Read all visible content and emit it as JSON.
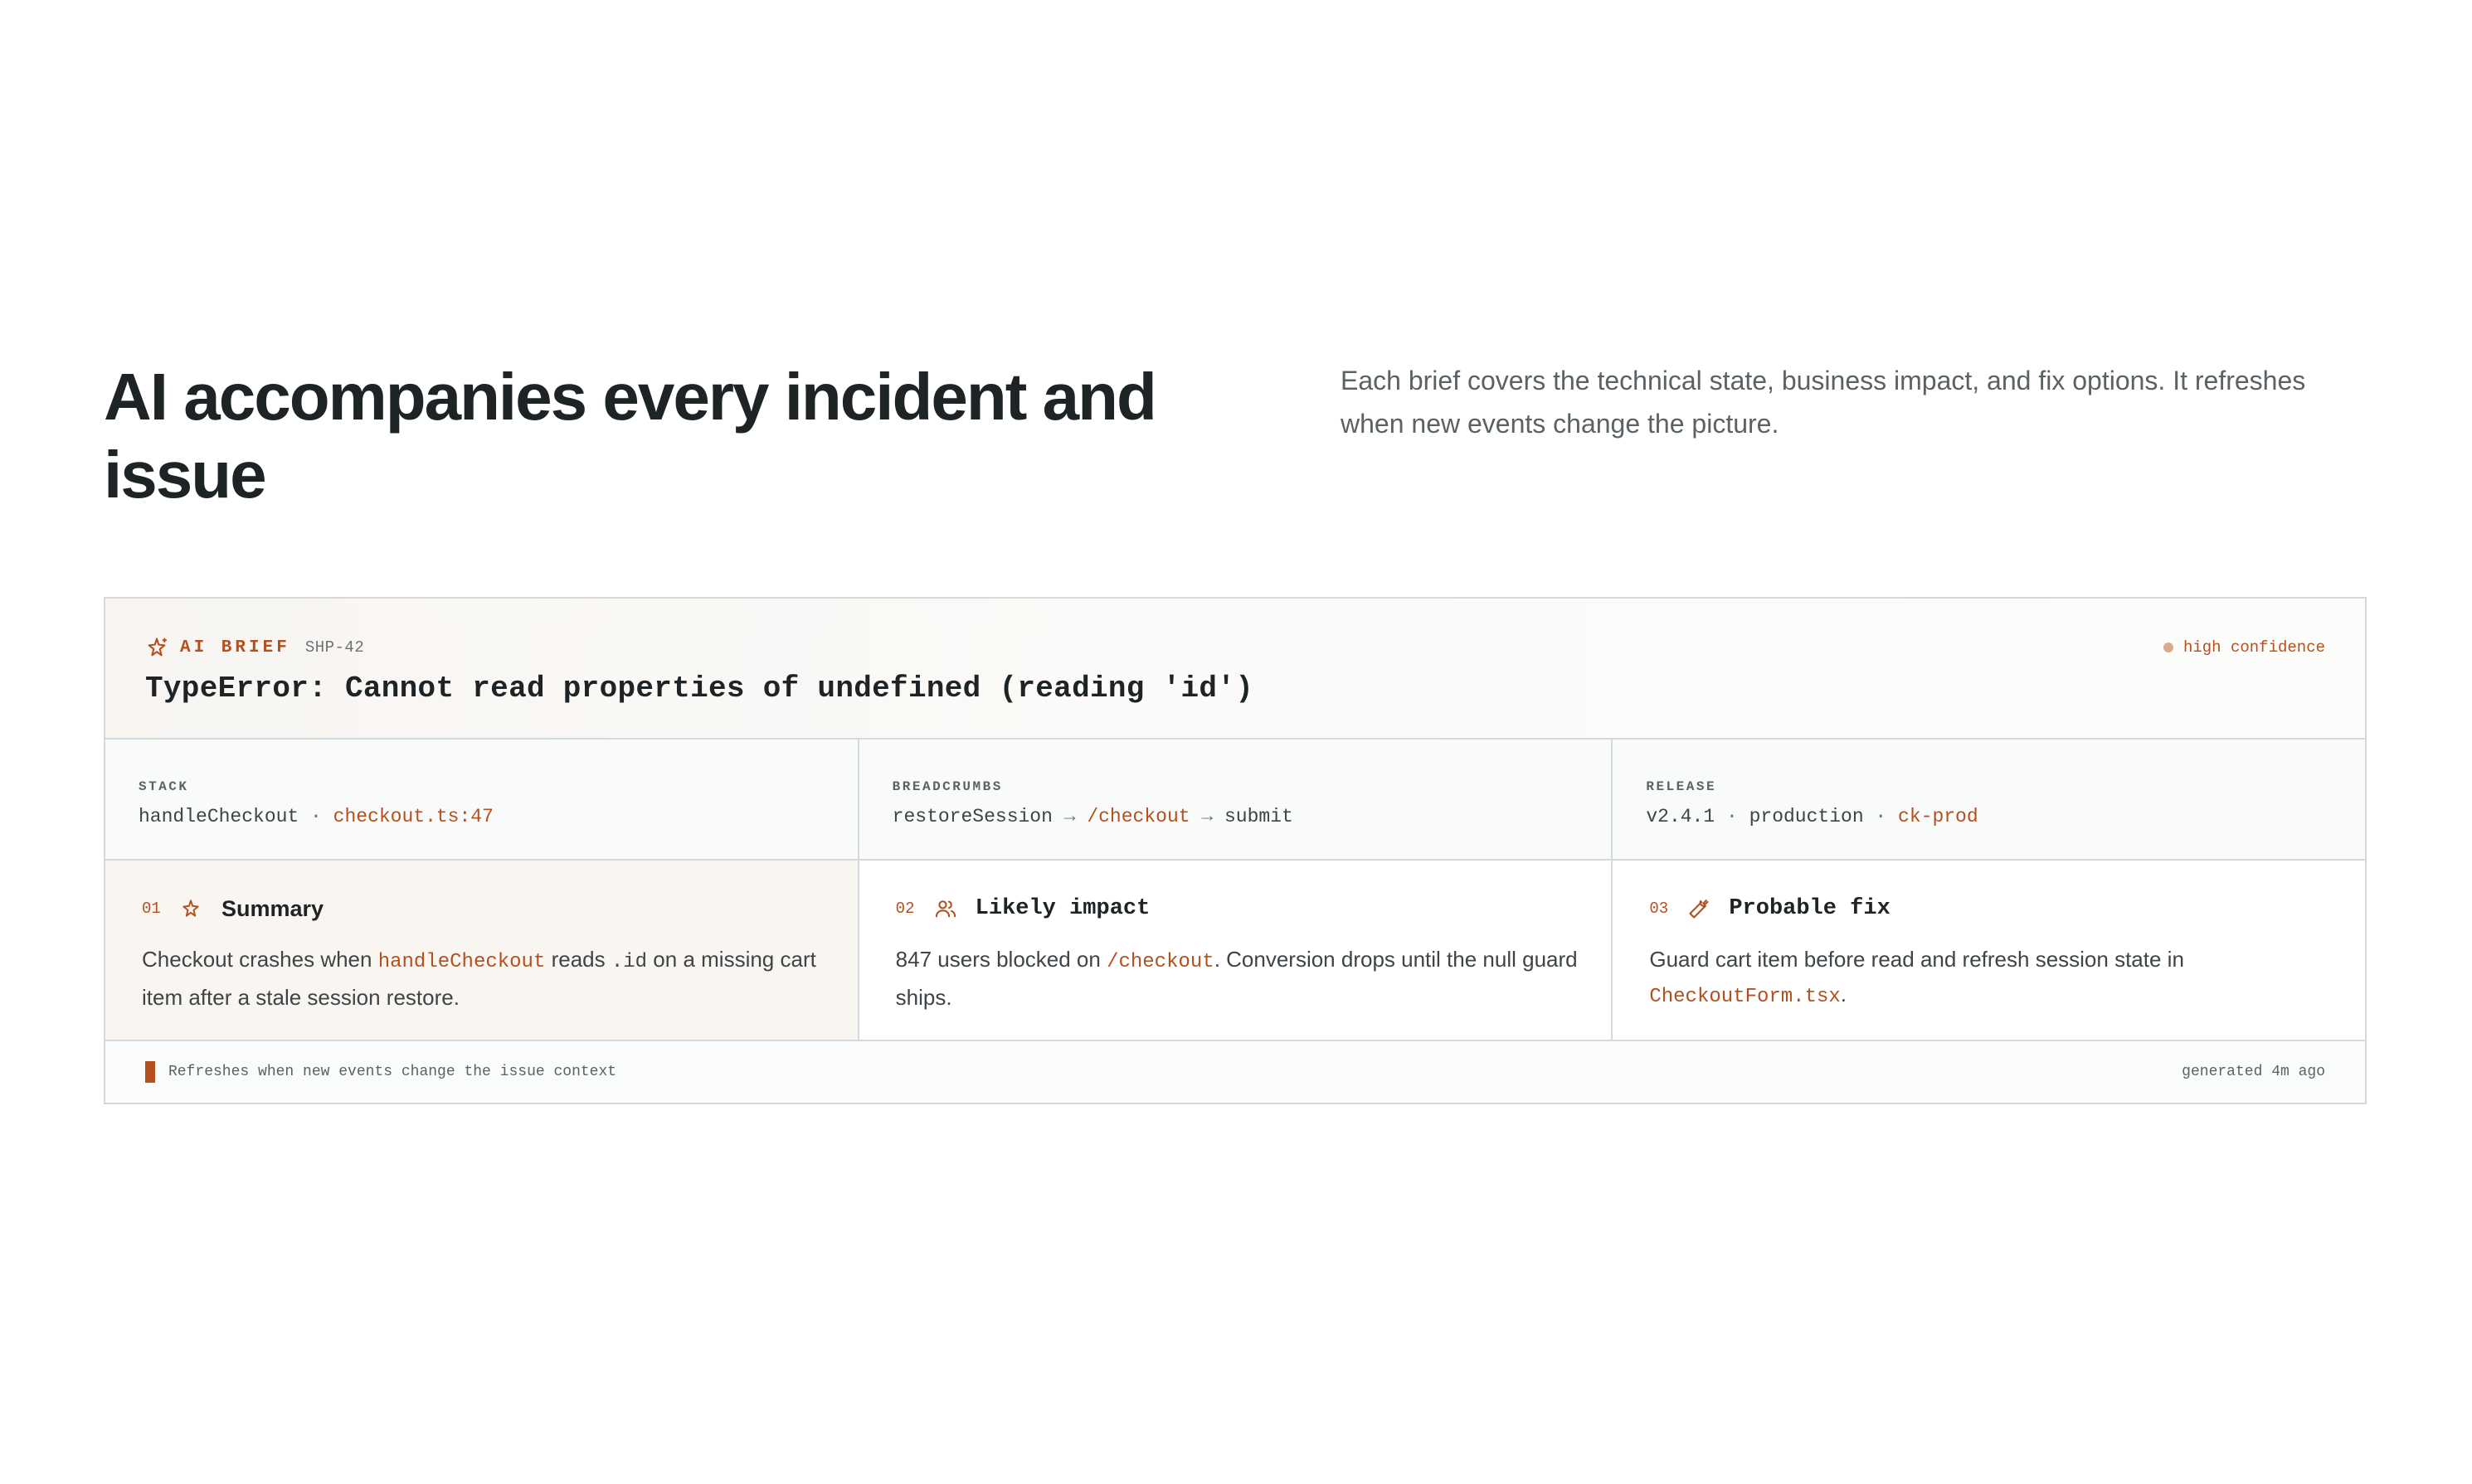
{
  "hero": {
    "title": "AI accompanies every incident and issue",
    "description": "Each brief covers the technical state, business impact, and fix options. It refreshes when new events change the picture."
  },
  "brief": {
    "label": "AI BRIEF",
    "issue_id": "SHP-42",
    "confidence": "high confidence",
    "error_title": "TypeError: Cannot read properties of undefined (reading 'id')",
    "icon": "sparkle-icon"
  },
  "meta": {
    "stack": {
      "label": "STACK",
      "function": "handleCheckout",
      "separator": " · ",
      "location": "checkout.ts:47"
    },
    "breadcrumbs": {
      "label": "BREADCRUMBS",
      "step1": "restoreSession",
      "arrow": " → ",
      "step2": "/checkout",
      "step3": "submit"
    },
    "release": {
      "label": "RELEASE",
      "version": "v2.4.1",
      "separator": " · ",
      "environment": "production",
      "project": "ck-prod"
    }
  },
  "insights": [
    {
      "number": "01",
      "title": "Summary",
      "icon": "sparkle-icon",
      "body_1": "Checkout crashes when ",
      "code_1": "handleCheckout",
      "body_2": " reads ",
      "code_2": ".id",
      "body_3": " on a missing cart item after a stale session restore."
    },
    {
      "number": "02",
      "title": "Likely impact",
      "icon": "users-icon",
      "body_1": "847 users blocked on ",
      "code_1": "/checkout",
      "body_2": ". Conversion drops until the null guard ships."
    },
    {
      "number": "03",
      "title": "Probable fix",
      "icon": "wrench-icon",
      "body_1": "Guard cart item before read and refresh session state in ",
      "code_1": "CheckoutForm.tsx",
      "body_2": "."
    }
  ],
  "footer": {
    "refresh_note": "Refreshes when new events change the issue context",
    "generated": "generated 4m ago"
  },
  "colors": {
    "accent": "#b4501e",
    "border": "#d6d9db",
    "text": "#1e2326"
  }
}
